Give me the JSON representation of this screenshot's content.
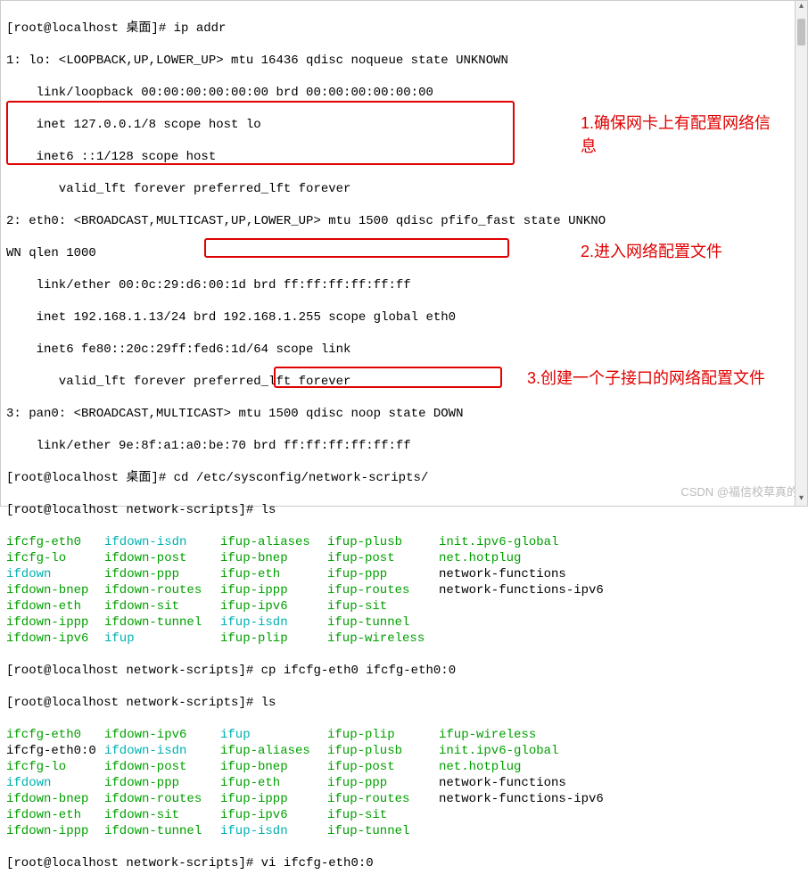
{
  "prompt1": "[root@localhost 桌面]# ip addr",
  "ipaddr": {
    "lo1": "1: lo: <LOOPBACK,UP,LOWER_UP> mtu 16436 qdisc noqueue state UNKNOWN",
    "lo2": "    link/loopback 00:00:00:00:00:00 brd 00:00:00:00:00:00",
    "lo3": "    inet 127.0.0.1/8 scope host lo",
    "lo4": "    inet6 ::1/128 scope host",
    "lo5": "       valid_lft forever preferred_lft forever",
    "e1": "2: eth0: <BROADCAST,MULTICAST,UP,LOWER_UP> mtu 1500 qdisc pfifo_fast state UNKNO",
    "e1b": "WN qlen 1000",
    "e2": "    link/ether 00:0c:29:d6:00:1d brd ff:ff:ff:ff:ff:ff",
    "e3": "    inet 192.168.1.13/24 brd 192.168.1.255 scope global eth0",
    "e4": "    inet6 fe80::20c:29ff:fed6:1d/64 scope link",
    "e5": "       valid_lft forever preferred_lft forever",
    "p1": "3: pan0: <BROADCAST,MULTICAST> mtu 1500 qdisc noop state DOWN",
    "p2": "    link/ether 9e:8f:a1:a0:be:70 brd ff:ff:ff:ff:ff:ff"
  },
  "prompt2a": "[root@localhost 桌面]# ",
  "cmd2": "cd /etc/sysconfig/network-scripts/",
  "prompt3": "[root@localhost network-scripts]# ls",
  "ls1": [
    [
      "ifcfg-eth0",
      "green",
      "ifdown-isdn",
      "cyan",
      "ifup-aliases",
      "green",
      "ifup-plusb",
      "green",
      "init.ipv6-global",
      "green"
    ],
    [
      "ifcfg-lo",
      "green",
      "ifdown-post",
      "green",
      "ifup-bnep",
      "green",
      "ifup-post",
      "green",
      "net.hotplug",
      "green"
    ],
    [
      "ifdown",
      "cyan",
      "ifdown-ppp",
      "green",
      "ifup-eth",
      "green",
      "ifup-ppp",
      "green",
      "network-functions",
      "black"
    ],
    [
      "ifdown-bnep",
      "green",
      "ifdown-routes",
      "green",
      "ifup-ippp",
      "green",
      "ifup-routes",
      "green",
      "network-functions-ipv6",
      "black"
    ],
    [
      "ifdown-eth",
      "green",
      "ifdown-sit",
      "green",
      "ifup-ipv6",
      "green",
      "ifup-sit",
      "green",
      "",
      ""
    ],
    [
      "ifdown-ippp",
      "green",
      "ifdown-tunnel",
      "green",
      "ifup-isdn",
      "cyan",
      "ifup-tunnel",
      "green",
      "",
      ""
    ],
    [
      "ifdown-ipv6",
      "green",
      "ifup",
      "cyan",
      "ifup-plip",
      "green",
      "ifup-wireless",
      "green",
      "",
      ""
    ]
  ],
  "prompt4a": "[root@localhost network-scripts]# ",
  "cmd4": "cp ifcfg-eth0 ifcfg-eth0:0",
  "prompt5": "[root@localhost network-scripts]# ls",
  "ls2": [
    [
      "ifcfg-eth0",
      "green",
      "ifdown-ipv6",
      "green",
      "ifup",
      "cyan",
      "ifup-plip",
      "green",
      "ifup-wireless",
      "green"
    ],
    [
      "ifcfg-eth0:0",
      "black",
      "ifdown-isdn",
      "cyan",
      "ifup-aliases",
      "green",
      "ifup-plusb",
      "green",
      "init.ipv6-global",
      "green"
    ],
    [
      "ifcfg-lo",
      "green",
      "ifdown-post",
      "green",
      "ifup-bnep",
      "green",
      "ifup-post",
      "green",
      "net.hotplug",
      "green"
    ],
    [
      "ifdown",
      "cyan",
      "ifdown-ppp",
      "green",
      "ifup-eth",
      "green",
      "ifup-ppp",
      "green",
      "network-functions",
      "black"
    ],
    [
      "ifdown-bnep",
      "green",
      "ifdown-routes",
      "green",
      "ifup-ippp",
      "green",
      "ifup-routes",
      "green",
      "network-functions-ipv6",
      "black"
    ],
    [
      "ifdown-eth",
      "green",
      "ifdown-sit",
      "green",
      "ifup-ipv6",
      "green",
      "ifup-sit",
      "green",
      "",
      ""
    ],
    [
      "ifdown-ippp",
      "green",
      "ifdown-tunnel",
      "green",
      "ifup-isdn",
      "cyan",
      "ifup-tunnel",
      "green",
      "",
      ""
    ]
  ],
  "prompt6": "[root@localhost network-scripts]# vi ifcfg-eth0:0",
  "annotations": {
    "a1": "1.确保网卡上有配置网络信息",
    "a2": "2.进入网络配置文件",
    "a3": "3.创建一个子接口的网络配置文件"
  },
  "watermark": "CSDN @福信校草真的"
}
